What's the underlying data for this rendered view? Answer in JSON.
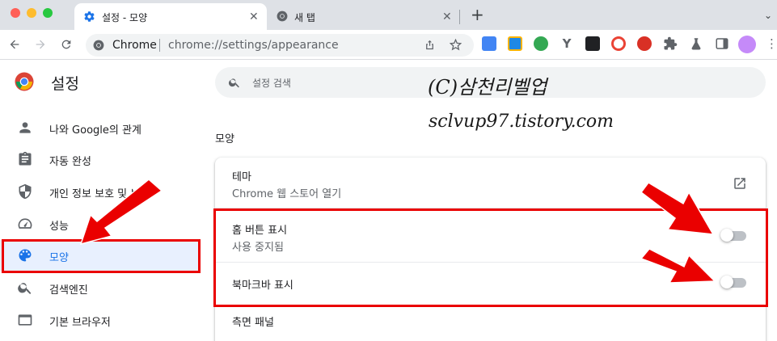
{
  "tabs": [
    {
      "title": "설정 - 모양",
      "active": true,
      "icon": "gear-icon"
    },
    {
      "title": "새 탭",
      "active": false,
      "icon": "chrome-icon"
    }
  ],
  "toolbar": {
    "site_label": "Chrome",
    "url": "chrome://settings/appearance"
  },
  "header": {
    "title": "설정"
  },
  "search": {
    "placeholder": "설정 검색"
  },
  "sidebar": {
    "items": [
      {
        "label": "나와 Google의 관계",
        "icon": "person-icon"
      },
      {
        "label": "자동 완성",
        "icon": "clipboard-icon"
      },
      {
        "label": "개인 정보 보호 및 보안",
        "icon": "shield-icon"
      },
      {
        "label": "성능",
        "icon": "speedometer-icon"
      },
      {
        "label": "모양",
        "icon": "palette-icon",
        "selected": true
      },
      {
        "label": "검색엔진",
        "icon": "search-icon"
      },
      {
        "label": "기본 브라우저",
        "icon": "browser-icon"
      }
    ]
  },
  "main": {
    "section_title": "모양",
    "rows": [
      {
        "title": "테마",
        "subtitle": "Chrome 웹 스토어 열기"
      },
      {
        "title": "홈 버튼 표시",
        "subtitle": "사용 중지됨",
        "toggle": false
      },
      {
        "title": "북마크바 표시",
        "toggle": false
      },
      {
        "title": "측면 패널"
      }
    ]
  },
  "watermark": {
    "line1": "(C)삼천리벨업",
    "line2": "sclvup97.tistory.com"
  },
  "colors": {
    "accent": "#1a73e8",
    "selected_bg": "#e8f0fe",
    "annotation_red": "#ea0000"
  }
}
